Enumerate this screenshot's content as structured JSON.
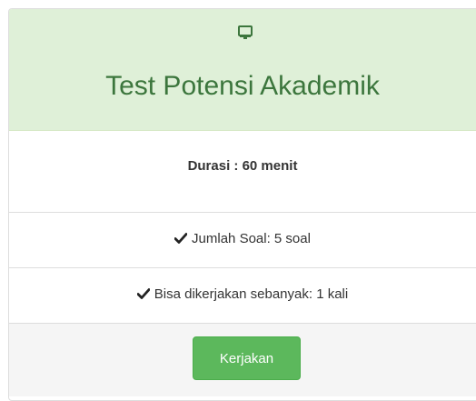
{
  "card": {
    "title": "Test Potensi Akademik",
    "icon": "monitor-icon",
    "duration": "Durasi : 60 menit",
    "items": [
      {
        "icon": "check-icon",
        "label": "Jumlah Soal: 5 soal"
      },
      {
        "icon": "check-icon",
        "label": "Bisa dikerjakan sebanyak: 1 kali"
      }
    ],
    "action_label": "Kerjakan"
  },
  "colors": {
    "heading_bg": "#dff0d8",
    "heading_text": "#3c763d",
    "button_bg": "#5cb85c",
    "footer_bg": "#f5f5f5"
  }
}
